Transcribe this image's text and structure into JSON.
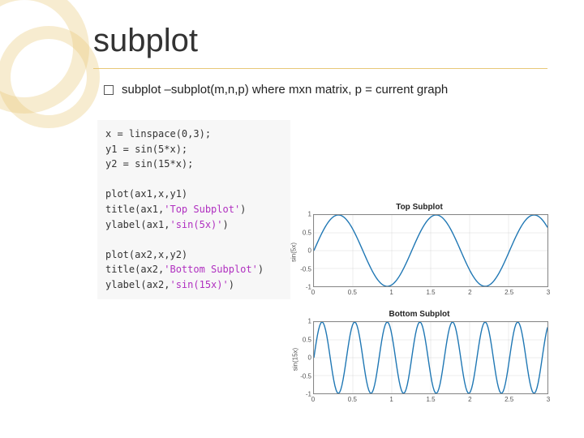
{
  "title": "subplot",
  "bullet": "subplot –subplot(m,n,p) where mxn matrix, p = current graph",
  "code": {
    "l1": "x = linspace(0,3);",
    "l2": "y1 = sin(5*x);",
    "l3": "y2 = sin(15*x);",
    "l4": "",
    "l5": "plot(ax1,x,y1)",
    "l6a": "title(ax1,",
    "l6b": "'Top Subplot'",
    "l6c": ")",
    "l7a": "ylabel(ax1,",
    "l7b": "'sin(5x)'",
    "l7c": ")",
    "l8": "",
    "l9": "plot(ax2,x,y2)",
    "l10a": "title(ax2,",
    "l10b": "'Bottom Subplot'",
    "l10c": ")",
    "l11a": "ylabel(ax2,",
    "l11b": "'sin(15x)'",
    "l11c": ")"
  },
  "chart_data": [
    {
      "type": "line",
      "title": "Top Subplot",
      "ylabel": "sin(5x)",
      "xlim": [
        0,
        3
      ],
      "ylim": [
        -1,
        1
      ],
      "xticks": [
        0,
        0.5,
        1,
        1.5,
        2,
        2.5,
        3
      ],
      "yticks": [
        -1,
        -0.5,
        0,
        0.5,
        1
      ],
      "series": [
        {
          "name": "sin(5x)",
          "expr": "sin(5x)"
        }
      ]
    },
    {
      "type": "line",
      "title": "Bottom Subplot",
      "ylabel": "sin(15x)",
      "xlim": [
        0,
        3
      ],
      "ylim": [
        -1,
        1
      ],
      "xticks": [
        0,
        0.5,
        1,
        1.5,
        2,
        2.5,
        3
      ],
      "yticks": [
        -1,
        -0.5,
        0,
        0.5,
        1
      ],
      "series": [
        {
          "name": "sin(15x)",
          "expr": "sin(15x)"
        }
      ]
    }
  ]
}
